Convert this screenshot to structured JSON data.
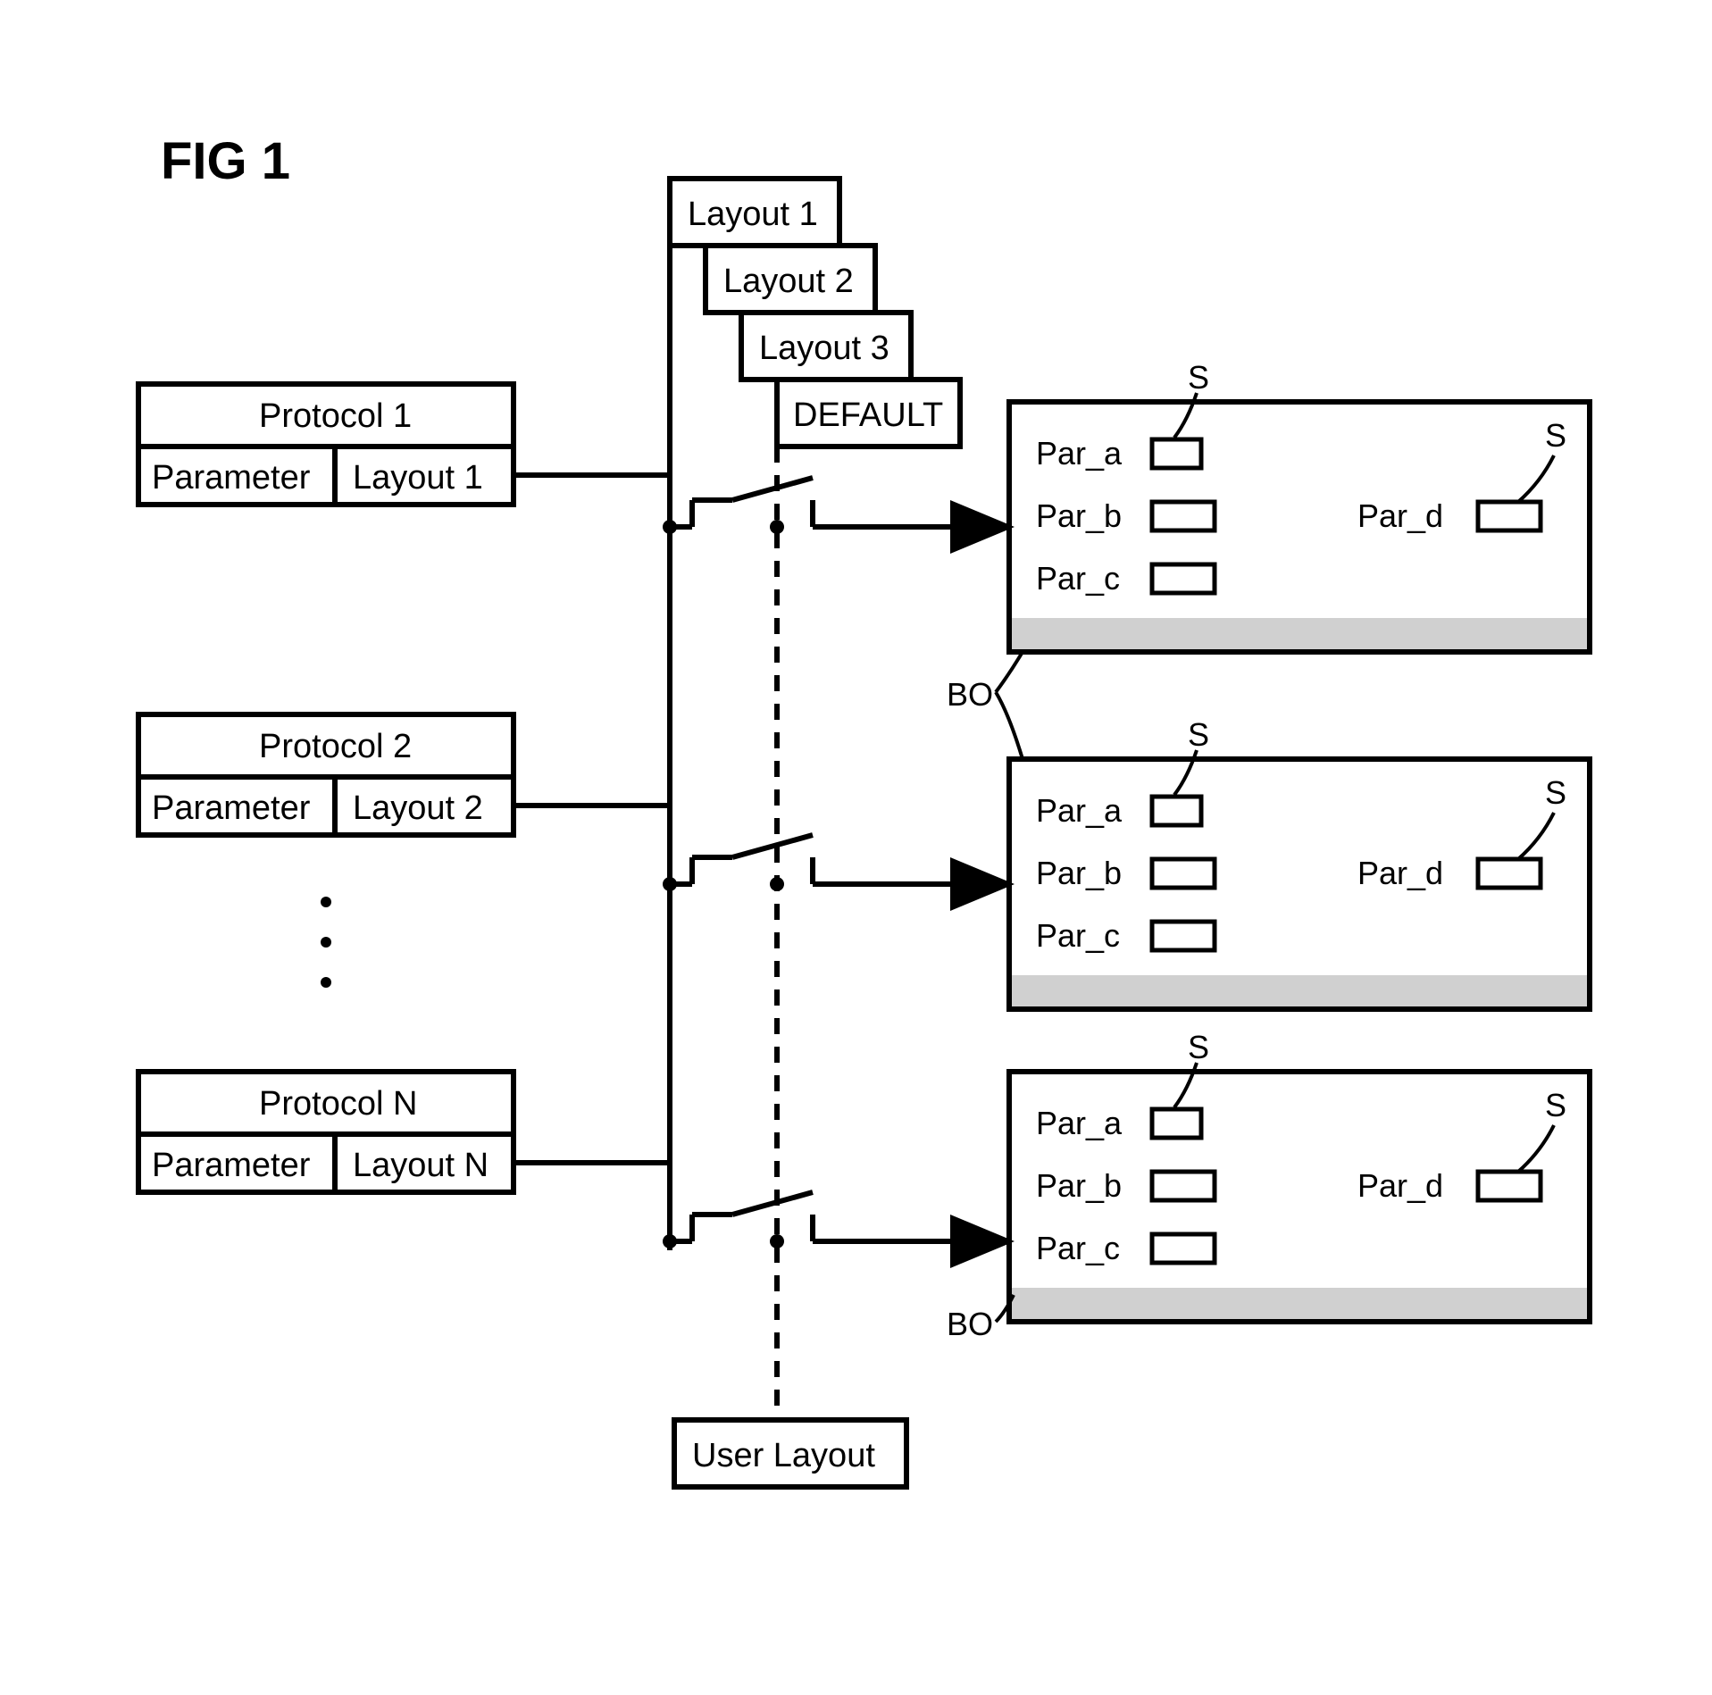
{
  "figure_label": "FIG 1",
  "protocols": [
    {
      "title": "Protocol 1",
      "param": "Parameter",
      "layout": "Layout 1"
    },
    {
      "title": "Protocol 2",
      "param": "Parameter",
      "layout": "Layout 2"
    },
    {
      "title": "Protocol N",
      "param": "Parameter",
      "layout": "Layout N"
    }
  ],
  "layout_stack": [
    "Layout 1",
    "Layout 2",
    "Layout 3",
    "DEFAULT"
  ],
  "user_layout": "User Layout",
  "panel_params": {
    "left": [
      "Par_a",
      "Par_b",
      "Par_c"
    ],
    "right": [
      "Par_d"
    ]
  },
  "annotations": {
    "S": "S",
    "BO": "BO"
  },
  "ellipsis_dots": 3
}
